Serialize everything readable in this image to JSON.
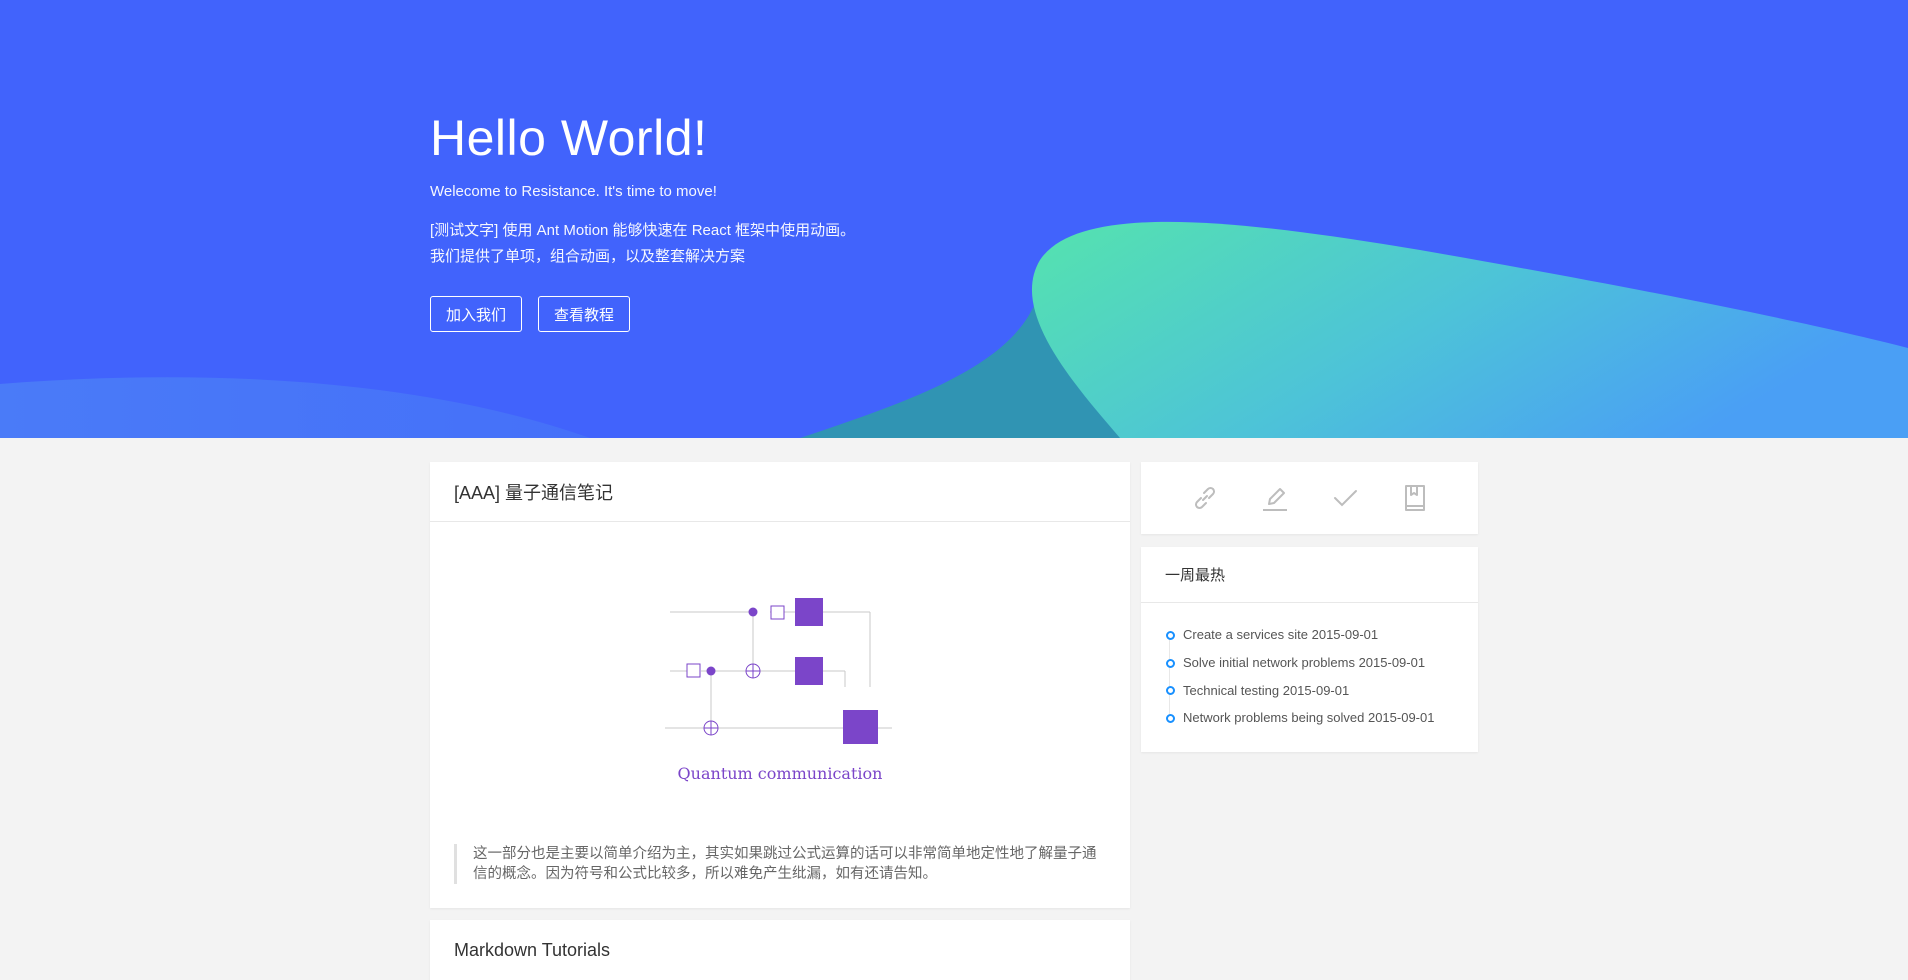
{
  "hero": {
    "title": "Hello World!",
    "subtitle": "Welecome to Resistance. It's time to move!",
    "desc_line1": "[测试文字] 使用 Ant Motion 能够快速在 React 框架中使用动画。",
    "desc_line2": "我们提供了单项，组合动画，以及整套解决方案",
    "join_button": "加入我们",
    "tutorial_button": "查看教程"
  },
  "colors": {
    "hero_bg": "#4163fc",
    "wave_green": "#52e0b0",
    "wave_blue": "#4a9ff5",
    "accent": "#1890ff",
    "figure_purple": "#7b45c9"
  },
  "post": {
    "title": "[AAA] 量子通信笔记",
    "figure_caption": "Quantum communication",
    "quote": "这一部分也是主要以简单介绍为主，其实如果跳过公式运算的话可以非常简单地定性地了解量子通信的概念。因为符号和公式比较多，所以难免产生纰漏，如有还请告知。"
  },
  "post2": {
    "title": "Markdown Tutorials"
  },
  "sidebar": {
    "icons": [
      "link-icon",
      "edit-icon",
      "check-icon",
      "book-icon"
    ],
    "hot_title": "一周最热",
    "hot_items": [
      "Create a services site 2015-09-01",
      "Solve initial network problems 2015-09-01",
      "Technical testing 2015-09-01",
      "Network problems being solved 2015-09-01"
    ]
  }
}
